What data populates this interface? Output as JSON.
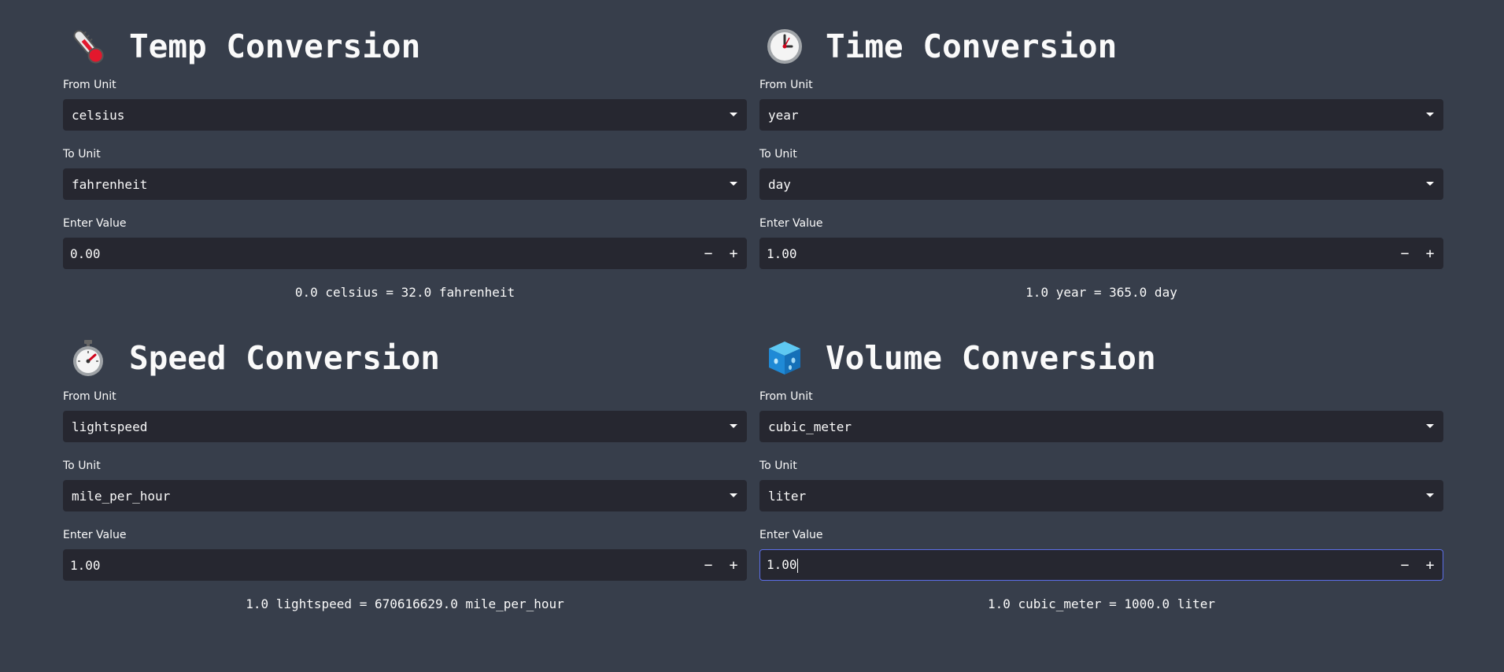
{
  "labels": {
    "from_unit": "From Unit",
    "to_unit": "To Unit",
    "enter_value": "Enter Value",
    "minus": "−",
    "plus": "+"
  },
  "cards": [
    {
      "title": "Temp Conversion",
      "icon": "thermometer-icon",
      "from": "celsius",
      "to": "fahrenheit",
      "value": "0.00",
      "result": "0.0 celsius = 32.0 fahrenheit"
    },
    {
      "title": "Time Conversion",
      "icon": "clock-icon",
      "from": "year",
      "to": "day",
      "value": "1.00",
      "result": "1.0 year = 365.0 day"
    },
    {
      "title": "Speed Conversion",
      "icon": "stopwatch-icon",
      "from": "lightspeed",
      "to": "mile_per_hour",
      "value": "1.00",
      "result": "1.0 lightspeed = 670616629.0 mile_per_hour"
    },
    {
      "title": "Volume Conversion",
      "icon": "ice-cube-icon",
      "from": "cubic_meter",
      "to": "liter",
      "value": "1.00",
      "result": "1.0 cubic_meter = 1000.0 liter"
    }
  ],
  "colors": {
    "background": "#373e4b",
    "input_bg": "#262730",
    "focus_border": "#5c6ee8",
    "text": "#fafafa"
  }
}
